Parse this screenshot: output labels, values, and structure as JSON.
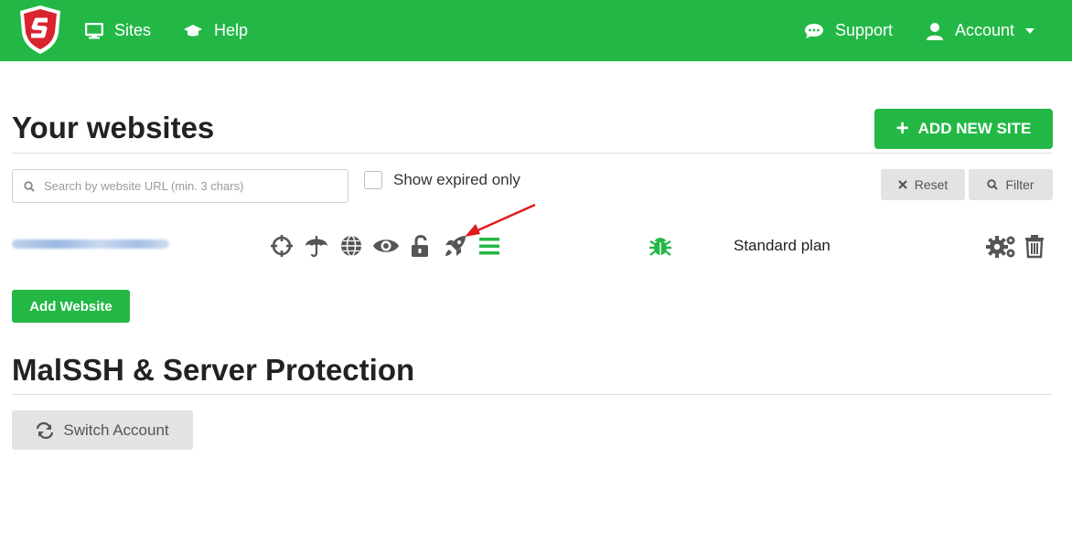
{
  "colors": {
    "brand_green": "#23b846",
    "grey_button": "#e3e3e3",
    "arrow_red": "#e01b1b"
  },
  "nav": {
    "logo_icon": "shield-s-logo",
    "sites": {
      "label": "Sites",
      "icon": "monitor-icon"
    },
    "help": {
      "label": "Help",
      "icon": "graduation-cap-icon"
    },
    "support": {
      "label": "Support",
      "icon": "chat-bubble-icon"
    },
    "account": {
      "label": "Account",
      "icon": "user-icon"
    }
  },
  "websites": {
    "title": "Your websites",
    "add_new_site": "ADD NEW SITE",
    "search_placeholder": "Search by website URL (min. 3 chars)",
    "show_expired_label": "Show expired only",
    "reset_label": "Reset",
    "filter_label": "Filter",
    "site_row": {
      "icons": [
        "crosshair-icon",
        "umbrella-icon",
        "globe-icon",
        "eye-icon",
        "unlock-icon",
        "rocket-icon",
        "list-icon",
        "bug-icon",
        "gears-icon",
        "trash-icon"
      ],
      "plan": "Standard plan"
    },
    "add_website": "Add Website"
  },
  "server": {
    "title": "MalSSH & Server Protection",
    "switch_account": "Switch Account"
  }
}
